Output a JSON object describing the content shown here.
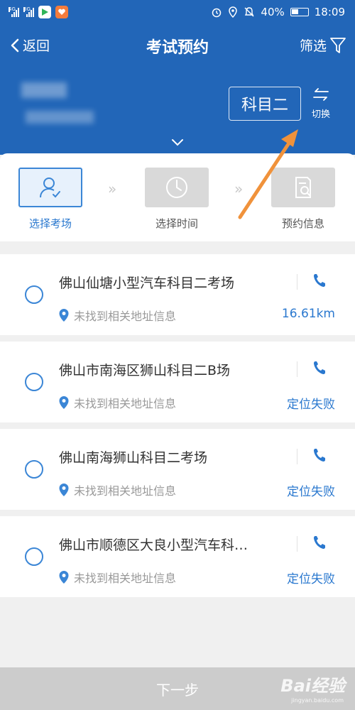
{
  "status_bar": {
    "network_1": "4G",
    "network_2": "3G",
    "battery": "40%",
    "time": "18:09"
  },
  "header": {
    "back_label": "返回",
    "title": "考试预约",
    "filter_label": "筛选"
  },
  "account": {
    "subject": "科目二",
    "switch_label": "切换"
  },
  "steps": [
    {
      "label": "选择考场",
      "active": true
    },
    {
      "label": "选择时间",
      "active": false
    },
    {
      "label": "预约信息",
      "active": false
    }
  ],
  "venues": [
    {
      "name": "佛山仙塘小型汽车科目二考场",
      "address": "未找到相关地址信息",
      "distance": "16.61km"
    },
    {
      "name": "佛山市南海区狮山科目二B场",
      "address": "未找到相关地址信息",
      "distance": "定位失败"
    },
    {
      "name": "佛山南海狮山科目二考场",
      "address": "未找到相关地址信息",
      "distance": "定位失败"
    },
    {
      "name": "佛山市顺德区大良小型汽车科…",
      "address": "未找到相关地址信息",
      "distance": "定位失败"
    }
  ],
  "next_button": "下一步",
  "watermark": {
    "logo": "Bai经验",
    "url": "jingyan.baidu.com"
  },
  "colors": {
    "primary": "#2266b8",
    "accent": "#2a78cf",
    "annotation_arrow": "#f0923b"
  }
}
